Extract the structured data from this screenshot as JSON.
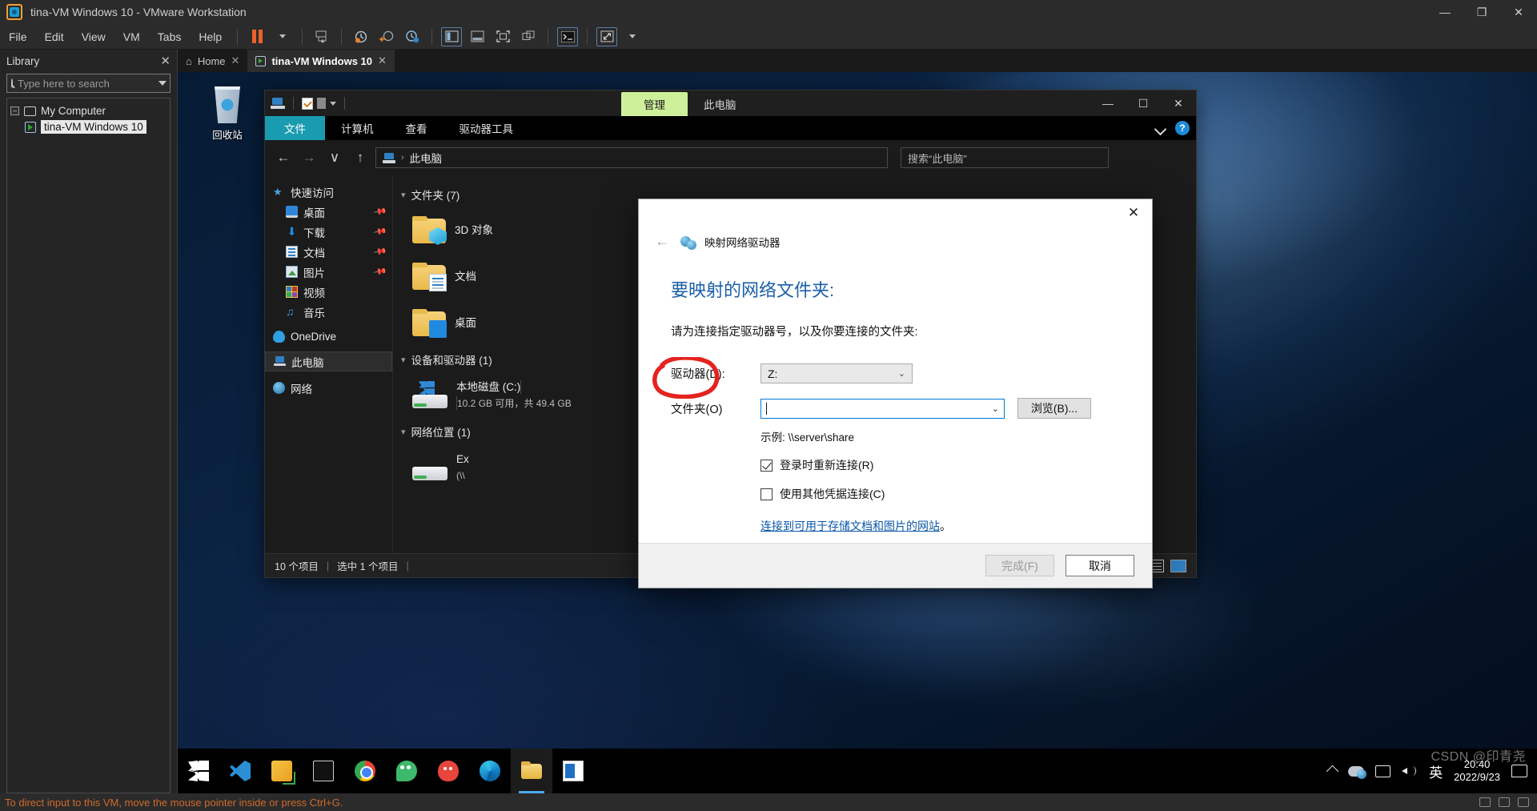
{
  "vmware": {
    "title": "tina-VM Windows 10 - VMware Workstation",
    "menu": [
      "File",
      "Edit",
      "View",
      "VM",
      "Tabs",
      "Help"
    ],
    "window_controls": {
      "minimize": "—",
      "maximize": "❐",
      "close": "✕"
    },
    "status_hint": "To direct input to this VM, move the mouse pointer inside or press Ctrl+G.",
    "library": {
      "title": "Library",
      "close_label": "✕",
      "search_placeholder": "Type here to search",
      "search_value": "",
      "tree": {
        "root": "My Computer",
        "child": "tina-VM Windows 10",
        "expander": "–"
      }
    },
    "tabs": [
      {
        "label": "Home",
        "icon": "home-icon",
        "close": "✕"
      },
      {
        "label": "tina-VM Windows 10",
        "icon": "vm-icon",
        "close": "✕"
      }
    ]
  },
  "guest": {
    "desktop": {
      "recycle_bin_label": "回收站"
    },
    "explorer": {
      "titlebar": {
        "ribbon_context_tab": "管理",
        "ribbon_context_sub": "此电脑",
        "minimize": "—",
        "maximize": "☐",
        "close": "✕"
      },
      "ribbon_tabs": [
        "文件",
        "计算机",
        "查看",
        "驱动器工具"
      ],
      "ribbon_help": "?",
      "nav": {
        "back": "←",
        "forward": "→",
        "recent": "∨",
        "up": "↑",
        "address_text": "此电脑",
        "address_chevron": "›",
        "search_placeholder": "搜索“此电脑”"
      },
      "sidebar": [
        {
          "label": "快速访问",
          "icon": "star-icon",
          "indent": false,
          "pinned": false
        },
        {
          "label": "桌面",
          "icon": "desktop-icon",
          "indent": true,
          "pinned": true
        },
        {
          "label": "下载",
          "icon": "download-icon",
          "indent": true,
          "pinned": true
        },
        {
          "label": "文档",
          "icon": "documents-icon",
          "indent": true,
          "pinned": true
        },
        {
          "label": "图片",
          "icon": "pictures-icon",
          "indent": true,
          "pinned": true
        },
        {
          "label": "视频",
          "icon": "videos-icon",
          "indent": true,
          "pinned": false
        },
        {
          "label": "音乐",
          "icon": "music-icon",
          "indent": true,
          "pinned": false
        },
        {
          "label": "OneDrive",
          "icon": "cloud-icon",
          "indent": false,
          "pinned": false
        },
        {
          "label": "此电脑",
          "icon": "this-pc-icon",
          "indent": false,
          "pinned": false,
          "selected": true
        },
        {
          "label": "网络",
          "icon": "network-icon",
          "indent": false,
          "pinned": false
        }
      ],
      "groups": [
        {
          "header": "文件夹 (7)",
          "items": [
            {
              "name": "3D 对象",
              "icon": "folder-3d-objects"
            },
            {
              "name": "文档",
              "icon": "folder-documents"
            },
            {
              "name": "桌面",
              "icon": "folder-desktop"
            }
          ]
        },
        {
          "header": "设备和驱动器 (1)",
          "items": [
            {
              "name": "本地磁盘 (C:)",
              "sub": "10.2 GB 可用，共 49.4 GB",
              "icon": "local-disk"
            }
          ]
        },
        {
          "header": "网络位置 (1)",
          "items": [
            {
              "name": "Ex",
              "sub": "(\\\\",
              "icon": "network-drive"
            }
          ]
        }
      ],
      "status": {
        "item_count": "10 个项目",
        "selection": "选中 1 个项目",
        "sep": "|"
      }
    },
    "map_network_drive": {
      "window_title": "映射网络驱动器",
      "back_arrow": "←",
      "close": "✕",
      "heading": "要映射的网络文件夹:",
      "description": "请为连接指定驱动器号，以及你要连接的文件夹:",
      "drive_label": "驱动器(D):",
      "drive_value": "Z:",
      "drive_chevron": "⌄",
      "folder_label": "文件夹(O)",
      "folder_value": "",
      "folder_chevron": "⌄",
      "browse_button": "浏览(B)...",
      "example_text": "示例: \\\\server\\share",
      "checkbox_reconnect": {
        "label": "登录时重新连接(R)",
        "checked": true
      },
      "checkbox_credentials": {
        "label": "使用其他凭据连接(C)",
        "checked": false
      },
      "link_text": "连接到可用于存储文档和图片的网站",
      "link_suffix": "。",
      "finish_button": "完成(F)",
      "cancel_button": "取消",
      "annotation_color": "#e5231f"
    },
    "taskbar": {
      "items": [
        {
          "name": "start-button",
          "icon": "windows-logo-icon"
        },
        {
          "name": "vscode",
          "icon": "vscode-icon"
        },
        {
          "name": "snipaste",
          "icon": "snip-icon"
        },
        {
          "name": "terminal",
          "icon": "terminal-icon"
        },
        {
          "name": "chrome",
          "icon": "chrome-icon"
        },
        {
          "name": "wechat",
          "icon": "wechat-icon"
        },
        {
          "name": "tim",
          "icon": "tim-icon"
        },
        {
          "name": "edge",
          "icon": "edge-icon"
        },
        {
          "name": "file-explorer",
          "icon": "folder-icon",
          "active": true
        },
        {
          "name": "outlook",
          "icon": "outlook-icon"
        }
      ],
      "tray": {
        "expand": "∧",
        "ime": "英",
        "time": "20:40",
        "date": "2022/9/23"
      }
    },
    "watermark": "CSDN @印青尧"
  }
}
